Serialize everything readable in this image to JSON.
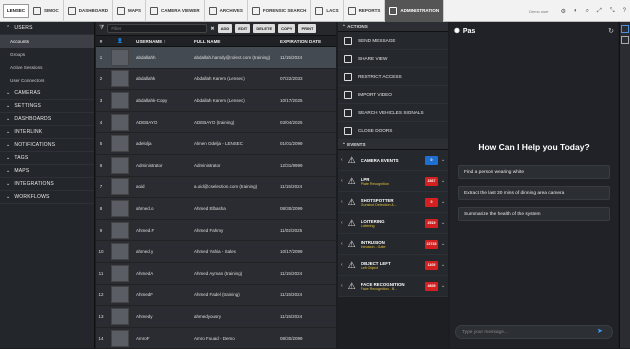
{
  "topbar": {
    "logo": "LENSEC",
    "tabs": [
      {
        "label": "SIMOC"
      },
      {
        "label": "DASHBOARD"
      },
      {
        "label": "MAPS"
      },
      {
        "label": "CAMERA VIEWER"
      },
      {
        "label": "ARCHIVES"
      },
      {
        "label": "FORENSIC SEARCH"
      },
      {
        "label": "LACS"
      },
      {
        "label": "REPORTS"
      },
      {
        "label": "ADMINISTRATION"
      }
    ],
    "user": "Demo user"
  },
  "nav": {
    "users": "USERS",
    "subs": [
      "Accounts",
      "Groups",
      "Active Sessions",
      "User Connectors"
    ],
    "items": [
      "CAMERAS",
      "SETTINGS",
      "DASHBOARDS",
      "INTERLINK",
      "NOTIFICATIONS",
      "TAGS",
      "MAPS",
      "INTEGRATIONS",
      "WORKFLOWS"
    ]
  },
  "grid": {
    "filter_placeholder": "Filter",
    "add": "ADD",
    "edit": "EDIT",
    "delete": "DELETE",
    "copy": "COPY",
    "print": "PRINT",
    "headers": {
      "num": "#",
      "username": "USERNAME ↑",
      "fullname": "FULL NAME",
      "exp": "EXPIRATION DATE"
    },
    "rows": [
      {
        "n": "1",
        "u": "abdallahh",
        "f": "abdallah.hamdy@rolect.com (training)",
        "e": "11/15/2024"
      },
      {
        "n": "2",
        "u": "abdallahk",
        "f": "Abdallah Karem (Lensec)",
        "e": "07/22/2033"
      },
      {
        "n": "3",
        "u": "abdallahk-Copy",
        "f": "Abdallah Karem (Lensec)",
        "e": "10/17/2025"
      },
      {
        "n": "4",
        "u": "ADEBAYO",
        "f": "ADEBAYO (training)",
        "e": "03/04/2025"
      },
      {
        "n": "5",
        "u": "adelolja",
        "f": "Almen Odelja - LENSEC",
        "e": "01/01/2099"
      },
      {
        "n": "6",
        "u": "Administrator",
        "f": "Administrator",
        "e": "12/31/9999"
      },
      {
        "n": "7",
        "u": "aoid",
        "f": "a.oid@cselection.com (training)",
        "e": "11/15/2024"
      },
      {
        "n": "8",
        "u": "ahmed.o",
        "f": "Ahmed Elbasha",
        "e": "08/30/2099"
      },
      {
        "n": "9",
        "u": "Ahmed.F",
        "f": "Ahmed Fahmy",
        "e": "11/02/2025"
      },
      {
        "n": "10",
        "u": "ahmed.y",
        "f": "Ahmed Yahia - Sales",
        "e": "10/17/2099"
      },
      {
        "n": "11",
        "u": "AhmedA",
        "f": "Ahmed Ayman (training)",
        "e": "11/15/2024"
      },
      {
        "n": "12",
        "u": "AhmedF",
        "f": "Ahmed Fadel (training)",
        "e": "11/15/2024"
      },
      {
        "n": "13",
        "u": "Ahmedy",
        "f": "ahmedyousry",
        "e": "11/15/2024"
      },
      {
        "n": "14",
        "u": "AmroF",
        "f": "Amro Fouad - Demo",
        "e": "08/30/2099"
      }
    ]
  },
  "actions": {
    "title": "ACTIONS",
    "items": [
      "SEND MESSAGE",
      "SHARE VIEW",
      "RESTRICT ACCESS",
      "IMPORT VIDEO",
      "SEARCH VEHICLES SIGNALS",
      "CLOSE DOORS"
    ]
  },
  "events": {
    "title": "EVENTS",
    "items": [
      {
        "t": "CAMERA EVENTS",
        "s": "",
        "count": "0",
        "color": "#1f6fd0"
      },
      {
        "t": "LPR",
        "s": "Plate Recognition",
        "count": "3367",
        "color": "#d32020"
      },
      {
        "t": "SHOTSPOTTER",
        "s": "Gunshot Detection &...",
        "count": "0",
        "color": "#d32020"
      },
      {
        "t": "LOITERING",
        "s": "Loitering",
        "count": "2519",
        "color": "#d32020"
      },
      {
        "t": "INTRUSION",
        "s": "Intrusion - Gate",
        "count": "22743",
        "color": "#d32020"
      },
      {
        "t": "OBJECT LEFT",
        "s": "Left Object",
        "count": "1105",
        "color": "#d32020"
      },
      {
        "t": "FACE RECOGNITION",
        "s": "Face Recognition - B...",
        "count": "4605",
        "color": "#d32020"
      }
    ]
  },
  "chat": {
    "logo": "Pas",
    "title": "How Can I Help you Today?",
    "suggestions": [
      "Find a person wearing white",
      "Extract the last 30 mins of dinning area camera",
      "Summarize the health of the system"
    ],
    "placeholder": "Type your message..."
  }
}
